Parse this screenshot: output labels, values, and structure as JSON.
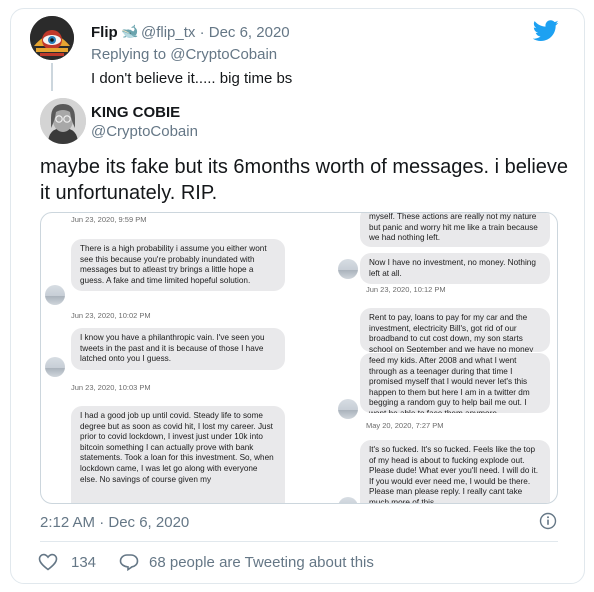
{
  "reply_context": {
    "name": "Flip",
    "handle_date": "@flip_tx · Dec 6, 2020",
    "replying_to": "Replying to @CryptoCobain",
    "text": "I don't believe it..... big time bs"
  },
  "tweet": {
    "name": "KING COBIE",
    "handle": "@CryptoCobain",
    "text": "maybe its fake but its 6months worth of messages. i believe it unfortunately. RIP.",
    "timestamp": "2:12 AM · Dec 6, 2020",
    "likes": "134",
    "tweeting": "68 people are Tweeting about this"
  },
  "media": {
    "left": [
      {
        "type": "ts",
        "text": "Jun 23, 2020, 9:59 PM"
      },
      {
        "type": "msg",
        "text": "There is a high probability i assume you either wont see this because you're probably inundated with messages but to atleast try brings a little hope a guess. A fake and time limited hopeful solution."
      },
      {
        "type": "ts",
        "text": "Jun 23, 2020, 10:02 PM"
      },
      {
        "type": "msg",
        "text": "I know you have a philanthropic vain. I've seen you tweets in the past and it is because of those I have latched onto you I guess."
      },
      {
        "type": "ts",
        "text": "Jun 23, 2020, 10:03 PM"
      },
      {
        "type": "msg",
        "text": "I had a good job up until covid. Steady life to some degree but as soon as covid hit, I lost my career. Just prior to covid lockdown, I invest just under 10k into bitcoin something I can actually prove with bank statements. Took a loan for this investment. So, when lockdown came, I was let go along with everyone else. No savings of course given my"
      }
    ],
    "right": [
      {
        "type": "msg",
        "text": "myself. These actions are really not my nature but panic and worry hit me like a train because we had nothing left."
      },
      {
        "type": "msg",
        "text": "Now I have no investment, no money. Nothing left at all."
      },
      {
        "type": "ts",
        "text": "Jun 23, 2020, 10:12 PM"
      },
      {
        "type": "msg",
        "text": "Rent to pay, loans to pay for my car and the investment, electricity Bill's, got rid of our broadband to cut cost down, my son starts school on September and we have no money"
      },
      {
        "type": "msg",
        "text": "feed my kids. After 2008 and what I went through as a teenager during that time I promised myself that I would never let's this happen to them but here I am in a twitter dm begging a random guy to help bail me out. I wont be able to face them anymore."
      },
      {
        "type": "ts",
        "text": "May 20, 2020, 7:27 PM"
      },
      {
        "type": "msg",
        "text": "It's so fucked. It's so fucked. Feels like the top of my head is about to fucking explode out. Please dude! What ever you'll need. I will do it. If you would ever need me, I would be there. Please man please reply. I really cant take much more of this."
      }
    ]
  },
  "colors": {
    "twitter_blue": "#1da1f2",
    "secondary_text": "#657786",
    "bubble": "#e9e9eb",
    "border": "#e1e8ed"
  },
  "icons": [
    "twitter-bird-icon",
    "whale-emoji-icon",
    "info-icon",
    "heart-icon",
    "comment-icon"
  ]
}
